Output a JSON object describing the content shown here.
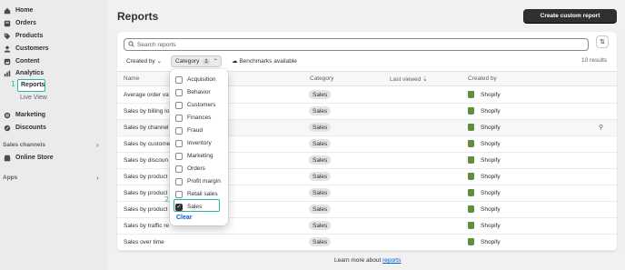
{
  "sidebar": {
    "items": [
      {
        "label": "Home",
        "icon": "home-icon"
      },
      {
        "label": "Orders",
        "icon": "orders-icon"
      },
      {
        "label": "Products",
        "icon": "tag-icon"
      },
      {
        "label": "Customers",
        "icon": "person-icon"
      },
      {
        "label": "Content",
        "icon": "content-icon"
      },
      {
        "label": "Analytics",
        "icon": "chart-icon"
      }
    ],
    "reports_label": "Reports",
    "live_view_label": "Live View",
    "marketing_label": "Marketing",
    "discounts_label": "Discounts",
    "sales_channels_label": "Sales channels",
    "online_store_label": "Online Store",
    "apps_label": "Apps",
    "step1": "1"
  },
  "header": {
    "title": "Reports",
    "create_label": "Create custom report"
  },
  "toolbar": {
    "search_placeholder": "Search reports",
    "created_by_label": "Created by",
    "category_label": "Category",
    "category_count": "1",
    "benchmarks_label": "Benchmarks available",
    "results_label": "10 results"
  },
  "table": {
    "columns": {
      "name": "Name",
      "category": "Category",
      "last_viewed": "Last viewed",
      "created_by": "Created by"
    },
    "rows": [
      {
        "name": "Average order va",
        "category": "Sales",
        "creator": "Shopify"
      },
      {
        "name": "Sales by billing lo",
        "category": "Sales",
        "creator": "Shopify"
      },
      {
        "name": "Sales by channel",
        "category": "Sales",
        "creator": "Shopify"
      },
      {
        "name": "Sales by custome",
        "category": "Sales",
        "creator": "Shopify"
      },
      {
        "name": "Sales by discoun",
        "category": "Sales",
        "creator": "Shopify"
      },
      {
        "name": "Sales by product",
        "category": "Sales",
        "creator": "Shopify"
      },
      {
        "name": "Sales by product",
        "category": "Sales",
        "creator": "Shopify"
      },
      {
        "name": "Sales by product",
        "category": "Sales",
        "creator": "Shopify"
      },
      {
        "name": "Sales by traffic re",
        "category": "Sales",
        "creator": "Shopify"
      },
      {
        "name": "Sales over time",
        "category": "Sales",
        "creator": "Shopify"
      }
    ]
  },
  "dropdown": {
    "options": [
      {
        "label": "Acquisition",
        "checked": false
      },
      {
        "label": "Behavior",
        "checked": false
      },
      {
        "label": "Customers",
        "checked": false
      },
      {
        "label": "Finances",
        "checked": false
      },
      {
        "label": "Fraud",
        "checked": false
      },
      {
        "label": "Inventory",
        "checked": false
      },
      {
        "label": "Marketing",
        "checked": false
      },
      {
        "label": "Orders",
        "checked": false
      },
      {
        "label": "Profit margin",
        "checked": false
      },
      {
        "label": "Retail sales",
        "checked": false
      },
      {
        "label": "Sales",
        "checked": true
      }
    ],
    "clear_label": "Clear",
    "step2": "2"
  },
  "footer": {
    "prefix": "Learn more about",
    "link": "reports"
  },
  "colors": {
    "accent_highlight": "#2bb5a8",
    "link": "#005bd3",
    "shopify_green": "#5e8e3e"
  }
}
